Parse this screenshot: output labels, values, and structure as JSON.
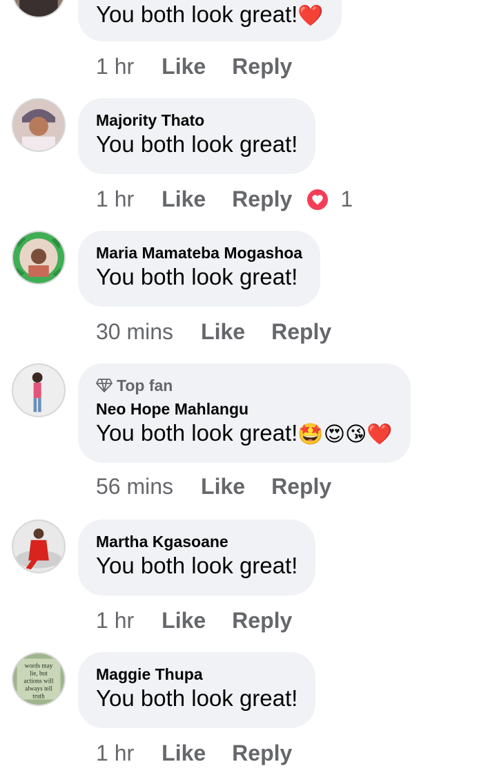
{
  "comments": [
    {
      "author": "",
      "text": "You both look great!",
      "emoji": "❤️",
      "time": "1 hr",
      "like": "Like",
      "reply": "Reply"
    },
    {
      "author": "Majority Thato",
      "text": "You both look great!",
      "time": "1 hr",
      "like": "Like",
      "reply": "Reply",
      "reaction_count": "1",
      "reaction_color": "#f33e58"
    },
    {
      "author": "Maria Mamateba Mogashoa",
      "text": "You both look great!",
      "time": "30 mins",
      "like": "Like",
      "reply": "Reply"
    },
    {
      "badge": "Top fan",
      "author": "Neo Hope Mahlangu",
      "text": "You both look great!",
      "emoji": "🤩😍😘❤️",
      "time": "56 mins",
      "like": "Like",
      "reply": "Reply"
    },
    {
      "author": "Martha Kgasoane",
      "text": "You both look great!",
      "time": "1 hr",
      "like": "Like",
      "reply": "Reply"
    },
    {
      "author": "Maggie Thupa",
      "text": "You both look great!",
      "time": "1 hr",
      "like": "Like",
      "reply": "Reply",
      "avatar_text": "words may lie, but actions will always tell truth"
    }
  ],
  "colors": {
    "bubble": "#f0f2f5",
    "meta": "#65676b",
    "heart": "#f33e58"
  }
}
